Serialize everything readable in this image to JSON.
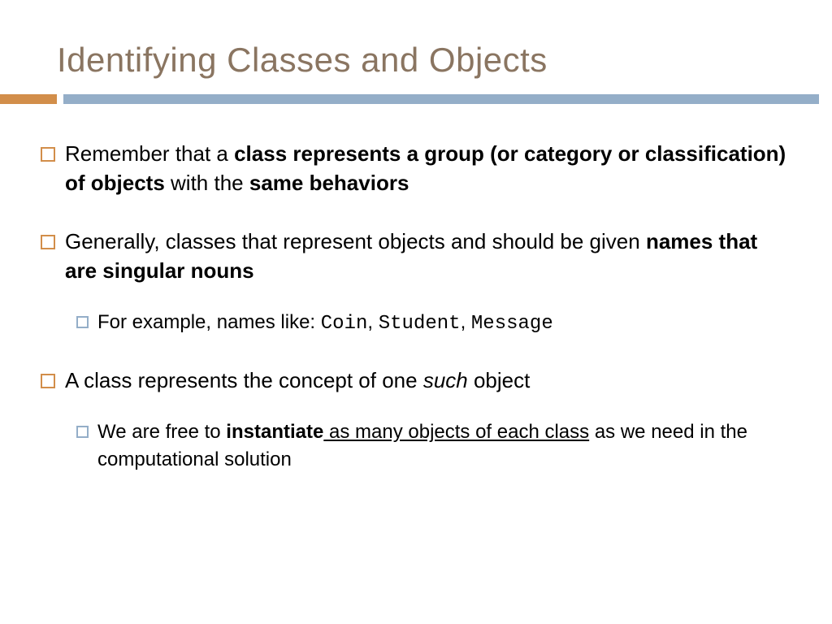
{
  "title": "Identifying Classes and Objects",
  "b1": {
    "p1": "Remember that a ",
    "p2": "class represents a group (or category or classification) of objects",
    "p3": " with the ",
    "p4": "same behaviors"
  },
  "b2": {
    "p1": "Generally, classes that represent objects and should be given ",
    "p2": "names that are singular nouns",
    "sub": {
      "p1": "For example, names like:  ",
      "c1": "Coin",
      "s1": ", ",
      "c2": "Student",
      "s2": ", ",
      "c3": "Message"
    }
  },
  "b3": {
    "p1": "A class represents the concept of one ",
    "p2": "such",
    "p3": " object",
    "sub": {
      "p1": "We are free to ",
      "p2": "instantiate",
      "p3": " as many objects of each class",
      "p4": " as we need in the computational solution"
    }
  }
}
